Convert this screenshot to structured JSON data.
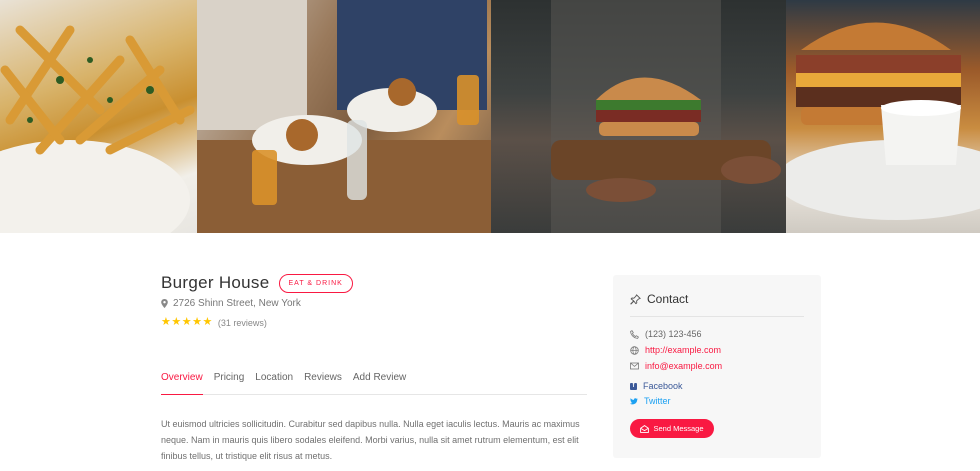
{
  "gallery": {
    "photos": [
      "fries-photo",
      "diners-photo",
      "burger-held-photo",
      "burger-closeup-photo"
    ]
  },
  "listing": {
    "title": "Burger House",
    "category": "EAT & DRINK",
    "address": "2726 Shinn Street, New York",
    "rating": 5,
    "reviews_text": "(31 reviews)"
  },
  "tabs": [
    {
      "label": "Overview",
      "active": true
    },
    {
      "label": "Pricing",
      "active": false
    },
    {
      "label": "Location",
      "active": false
    },
    {
      "label": "Reviews",
      "active": false
    },
    {
      "label": "Add Review",
      "active": false
    }
  ],
  "description": "Ut euismod ultricies sollicitudin. Curabitur sed dapibus nulla. Nulla eget iaculis lectus. Mauris ac maximus neque. Nam in mauris quis libero sodales eleifend. Morbi varius, nulla sit amet rutrum elementum, est elit finibus tellus, ut tristique elit risus at metus.",
  "contact": {
    "heading": "Contact",
    "phone": "(123) 123-456",
    "website": "http://example.com",
    "email": "info@example.com",
    "facebook": "Facebook",
    "twitter": "Twitter",
    "send_label": "Send Message"
  },
  "colors": {
    "accent": "#f91942",
    "star": "#ffc600",
    "facebook": "#3b5998",
    "twitter": "#1da1f2"
  }
}
